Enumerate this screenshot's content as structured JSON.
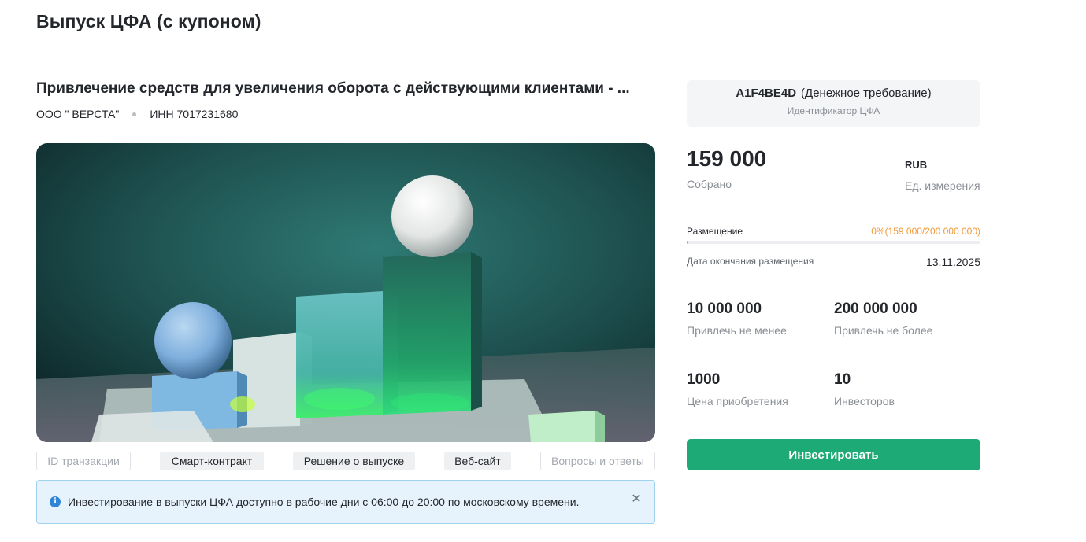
{
  "page": {
    "title": "Выпуск ЦФА (с купоном)"
  },
  "issue": {
    "title": "Привлечение средств для увеличения оборота с действующими клиентами - ...",
    "issuer_name": "ООО \" ВЕРСТА\"",
    "issuer_inn": "ИНН 7017231680"
  },
  "links": [
    {
      "label": "ID транзакции",
      "enabled": false
    },
    {
      "label": "Смарт-контракт",
      "enabled": true
    },
    {
      "label": "Решение о выпуске",
      "enabled": true
    },
    {
      "label": "Веб-сайт",
      "enabled": true
    },
    {
      "label": "Вопросы и ответы",
      "enabled": false
    }
  ],
  "notice": {
    "text": "Инвестирование в выпуски ЦФА доступно в рабочие дни с 06:00 до 20:00 по московскому времени."
  },
  "token": {
    "code": "A1F4BE4D",
    "type": "(Денежное требование)",
    "caption": "Идентификатор ЦФА"
  },
  "raised": {
    "value": "159 000",
    "caption": "Собрано",
    "unit": "RUB",
    "unit_caption": "Ед. измерения"
  },
  "placement": {
    "label": "Размещение",
    "percent_text": "0%(159 000/200 000 000)",
    "progress_fraction": 0.0008,
    "end_label": "Дата окончания размещения",
    "end_date": "13.11.2025"
  },
  "stats": {
    "min_value": "10 000 000",
    "min_caption": "Привлечь не менее",
    "max_value": "200 000 000",
    "max_caption": "Привлечь не более",
    "price_value": "1000",
    "price_caption": "Цена приобретения",
    "investors_value": "10",
    "investors_caption": "Инвесторов"
  },
  "actions": {
    "invest_label": "Инвестировать"
  },
  "colors": {
    "accent_green": "#1daa77",
    "progress_orange": "#f2993a",
    "notice_bg": "#e7f3fc",
    "info_blue": "#2f86d8"
  }
}
